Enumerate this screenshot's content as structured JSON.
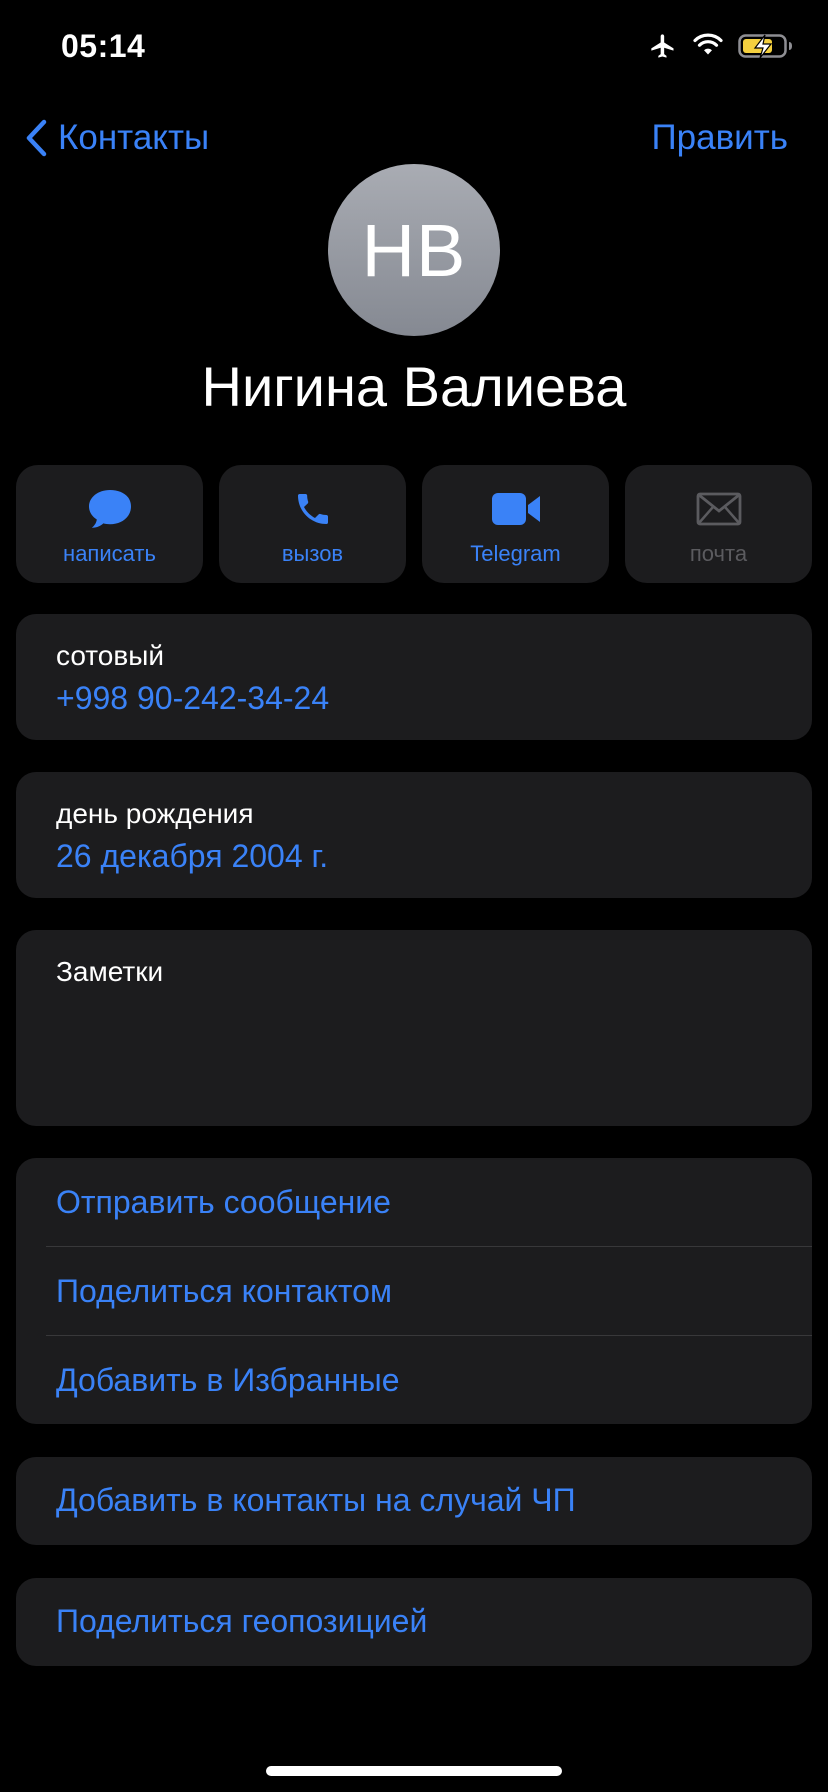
{
  "status_bar": {
    "time": "05:14",
    "icons": [
      "airplane-icon",
      "wifi-icon",
      "battery-charging-icon"
    ]
  },
  "nav": {
    "back_label": "Контакты",
    "edit_label": "Править"
  },
  "contact": {
    "initials": "НВ",
    "name": "Нигина Валиева"
  },
  "actions": [
    {
      "label": "написать",
      "icon": "message-bubble-icon",
      "enabled": true
    },
    {
      "label": "вызов",
      "icon": "phone-icon",
      "enabled": true
    },
    {
      "label": "Telegram",
      "icon": "video-camera-icon",
      "enabled": true
    },
    {
      "label": "почта",
      "icon": "mail-icon",
      "enabled": false
    }
  ],
  "phone": {
    "caption": "сотовый",
    "value": "+998 90-242-34-24"
  },
  "birthday": {
    "caption": "день рождения",
    "value": "26 декабря 2004 г."
  },
  "notes": {
    "caption": "Заметки"
  },
  "options": [
    {
      "label": "Отправить сообщение"
    },
    {
      "label": "Поделиться контактом"
    },
    {
      "label": "Добавить в Избранные"
    }
  ],
  "emergency": {
    "label": "Добавить в контакты на случай ЧП"
  },
  "location": {
    "label": "Поделиться геопозицией"
  },
  "colors": {
    "accent": "#3a82f7",
    "card_bg": "#1c1c1e",
    "background": "#000000",
    "battery_fill": "#f4d03f"
  }
}
